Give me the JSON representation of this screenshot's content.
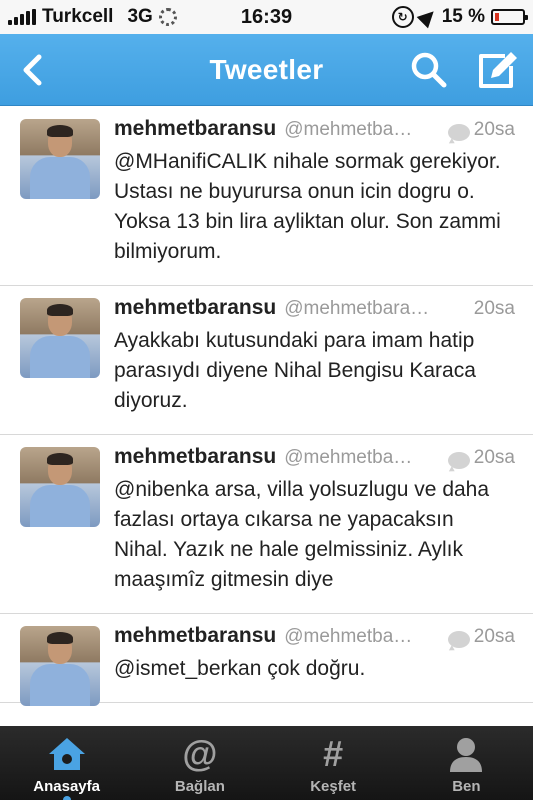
{
  "status_bar": {
    "carrier": "Turkcell",
    "network": "3G",
    "time": "16:39",
    "battery_percent": "15 %",
    "battery_level": 0.15
  },
  "nav": {
    "title": "Tweetler"
  },
  "tweets": [
    {
      "name": "mehmetbaransu",
      "handle": "@mehmetba…",
      "time": "20sa",
      "text": "@MHanifiCALIK nihale sormak gerekiyor. Ustası ne buyurursa onun icin dogru o. Yoksa 13 bin lira ayliktan olur. Son zammi bilmiyorum."
    },
    {
      "name": "mehmetbaransu",
      "handle": "@mehmetbara…",
      "time": "20sa",
      "text": "Ayakkabı kutusundaki para imam hatip parasıydı diyene Nihal Bengisu Karaca diyoruz."
    },
    {
      "name": "mehmetbaransu",
      "handle": "@mehmetba…",
      "time": "20sa",
      "text": "@nibenka arsa, villa yolsuzlugu ve daha fazlası ortaya cıkarsa ne yapacaksın Nihal. Yazık ne hale gelmissiniz. Aylık maaşımîz gitmesin diye"
    },
    {
      "name": "mehmetbaransu",
      "handle": "@mehmetba…",
      "time": "20sa",
      "text": "@ismet_berkan çok doğru."
    }
  ],
  "tabs": [
    {
      "label": "Anasayfa",
      "icon": "home-icon"
    },
    {
      "label": "Bağlan",
      "icon": "at-icon"
    },
    {
      "label": "Keşfet",
      "icon": "hash-icon"
    },
    {
      "label": "Ben",
      "icon": "person-icon"
    }
  ],
  "colors": {
    "nav_blue": "#4aa3e3",
    "tab_bar": "#1c1c1c",
    "battery_low": "#d6331f"
  }
}
